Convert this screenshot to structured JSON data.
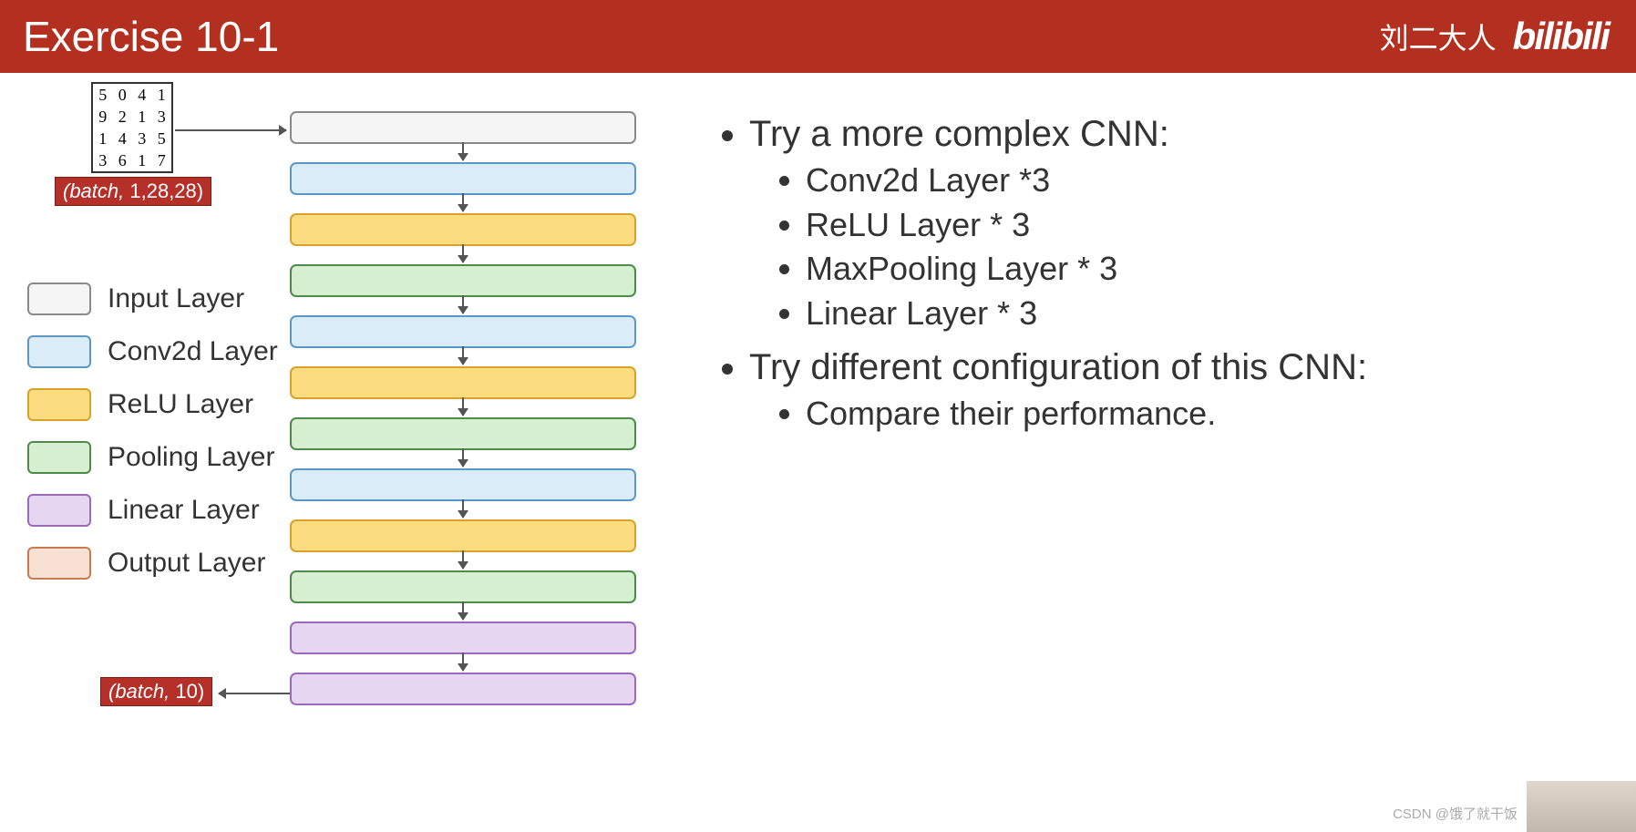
{
  "header": {
    "title": "Exercise 10-1",
    "author": "刘二大人",
    "logo_text": "bilibili"
  },
  "mnist_digits": [
    "5",
    "0",
    "4",
    "1",
    "9",
    "2",
    "1",
    "3",
    "1",
    "4",
    "3",
    "5",
    "3",
    "6",
    "1",
    "7"
  ],
  "shape_in": {
    "italic": "(batch,",
    "rest": " 1,28,28)"
  },
  "shape_out": {
    "italic": "(batch,",
    "rest": " 10)"
  },
  "legend": [
    {
      "label": "Input Layer",
      "cls": "c-input"
    },
    {
      "label": "Conv2d Layer",
      "cls": "c-conv"
    },
    {
      "label": "ReLU Layer",
      "cls": "c-relu"
    },
    {
      "label": "Pooling Layer",
      "cls": "c-pool"
    },
    {
      "label": "Linear Layer",
      "cls": "c-linear"
    },
    {
      "label": "Output Layer",
      "cls": "c-output"
    }
  ],
  "network": [
    "c-input",
    "c-conv",
    "c-relu",
    "c-pool",
    "c-conv",
    "c-relu",
    "c-pool",
    "c-conv",
    "c-relu",
    "c-pool",
    "c-linear",
    "c-linear"
  ],
  "bullets": {
    "b1": "Try a more complex CNN:",
    "b1_items": [
      "Conv2d Layer *3",
      "ReLU Layer * 3",
      "MaxPooling Layer * 3",
      "Linear Layer * 3"
    ],
    "b2": "Try different configuration of this CNN:",
    "b2_items": [
      "Compare their performance."
    ]
  },
  "watermark": "CSDN @饿了就干饭"
}
